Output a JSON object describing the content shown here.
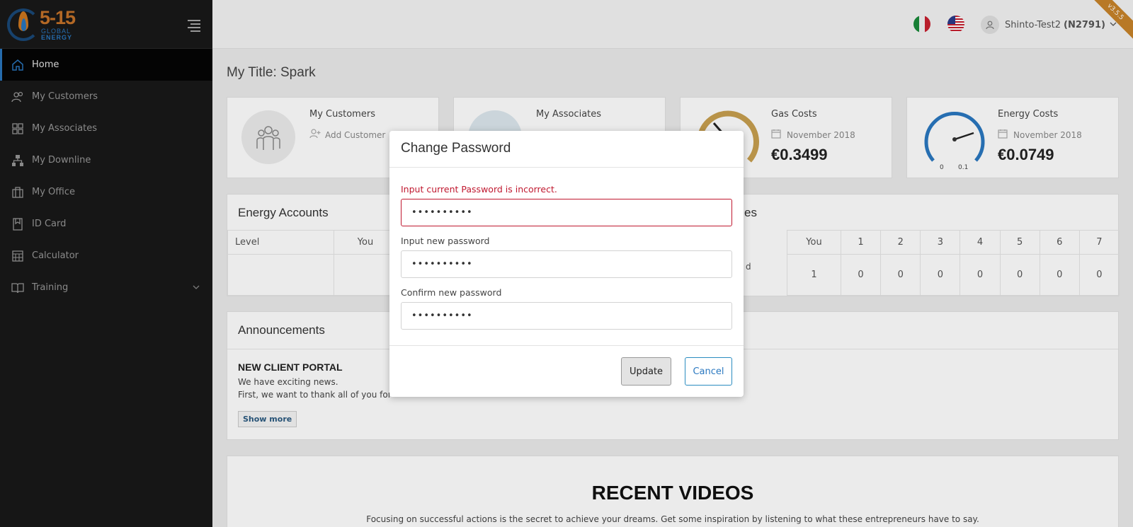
{
  "brand": {
    "name": "5-15",
    "sub1": "GLOBAL",
    "sub2": "ENERGY"
  },
  "sidebar": {
    "items": [
      {
        "label": "Home",
        "icon": "home-icon",
        "active": true
      },
      {
        "label": "My Customers",
        "icon": "users-icon"
      },
      {
        "label": "My Associates",
        "icon": "grid-icon"
      },
      {
        "label": "My Downline",
        "icon": "sitemap-icon"
      },
      {
        "label": "My Office",
        "icon": "briefcase-icon"
      },
      {
        "label": "ID Card",
        "icon": "id-card-icon"
      },
      {
        "label": "Calculator",
        "icon": "calculator-icon"
      },
      {
        "label": "Training",
        "icon": "book-icon",
        "expandable": true
      }
    ]
  },
  "topbar": {
    "user_name": "Shinto-Test2",
    "user_id": "(N2791)",
    "ribbon": "v3.5.5"
  },
  "main": {
    "page_title": "My Title: Spark",
    "cards": {
      "customers": {
        "title": "My Customers",
        "action": "Add Customer"
      },
      "associates": {
        "title": "My Associates"
      },
      "gas": {
        "title": "Gas Costs",
        "date": "November 2018",
        "value": "€0.3499"
      },
      "energy": {
        "title": "Energy Costs",
        "date": "November 2018",
        "value": "€0.0749",
        "gauge_min": "0",
        "gauge_max": "0.1"
      }
    },
    "energy_accounts": {
      "title": "Energy Accounts",
      "headers": [
        "Level",
        "You"
      ]
    },
    "right_table": {
      "title_fragment": "es",
      "headers": [
        "You",
        "1",
        "2",
        "3",
        "4",
        "5",
        "6",
        "7"
      ],
      "row_label_fragment": "d",
      "row": [
        "1",
        "0",
        "0",
        "0",
        "0",
        "0",
        "0",
        "0"
      ]
    },
    "announcements": {
      "title": "Announcements",
      "headline": "NEW CLIENT PORTAL",
      "line1": "We have exciting news.",
      "line2": "First, we want to thank all of you for",
      "show_more": "Show more"
    },
    "videos": {
      "title": "RECENT VIDEOS",
      "subtitle": "Focusing on successful actions is the secret to achieve your dreams. Get some inspiration by listening to what these entrepreneurs have to say."
    }
  },
  "modal": {
    "title": "Change Password",
    "current_label": "Input current Password is incorrect.",
    "current_value": "••••••••••",
    "new_label": "Input new password",
    "new_value": "••••••••••",
    "confirm_label": "Confirm new password",
    "confirm_value": "••••••••••",
    "update_label": "Update",
    "cancel_label": "Cancel"
  },
  "colors": {
    "sidebar_bg": "#191919",
    "accent": "#2a78c0",
    "error": "#c0182f",
    "brand_orange": "#c8742a"
  }
}
